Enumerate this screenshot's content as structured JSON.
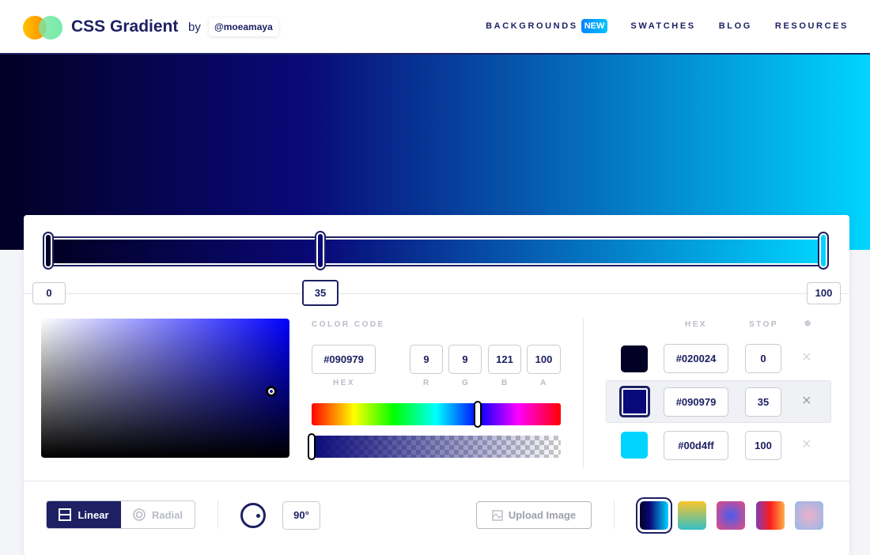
{
  "header": {
    "brand": "CSS Gradient",
    "by": "by",
    "author": "@moeamaya",
    "nav": [
      {
        "label": "BACKGROUNDS",
        "badge": "NEW"
      },
      {
        "label": "SWATCHES"
      },
      {
        "label": "BLOG"
      },
      {
        "label": "RESOURCES"
      }
    ]
  },
  "gradient": {
    "type": "linear",
    "angle_label": "90°",
    "stops": [
      {
        "hex": "#020024",
        "stop": "0"
      },
      {
        "hex": "#090979",
        "stop": "35"
      },
      {
        "hex": "#00d4ff",
        "stop": "100"
      }
    ],
    "selected_stop_index": 1
  },
  "color_code": {
    "title": "COLOR CODE",
    "hex": "#090979",
    "hex_label": "HEX",
    "r": "9",
    "g": "9",
    "b": "121",
    "a": "100",
    "r_label": "R",
    "g_label": "G",
    "b_label": "B",
    "a_label": "A",
    "hue_fraction": 0.667,
    "alpha_percent": 100
  },
  "stops_table": {
    "hex_header": "HEX",
    "stop_header": "STOP",
    "remove_symbol": "×",
    "header_icon": "⊕"
  },
  "bottom": {
    "linear_label": "Linear",
    "radial_label": "Radial",
    "upload_label": "Upload Image",
    "presets": [
      {
        "name": "current",
        "css": "linear-gradient(90deg,#020024,#090979 35%,#00d4ff)"
      },
      {
        "name": "sunny-teal",
        "css": "linear-gradient(180deg,#fcc52b,#33bfc4)"
      },
      {
        "name": "pink-blue-radial",
        "css": "radial-gradient(circle,#4a5cf0,#e64b7e)"
      },
      {
        "name": "purple-orange",
        "css": "linear-gradient(90deg,#833ab4,#fd1d1d 50%,#fcb045)"
      },
      {
        "name": "pastel-radial",
        "css": "radial-gradient(circle,#eeaeca,#94bbe9)"
      }
    ]
  }
}
